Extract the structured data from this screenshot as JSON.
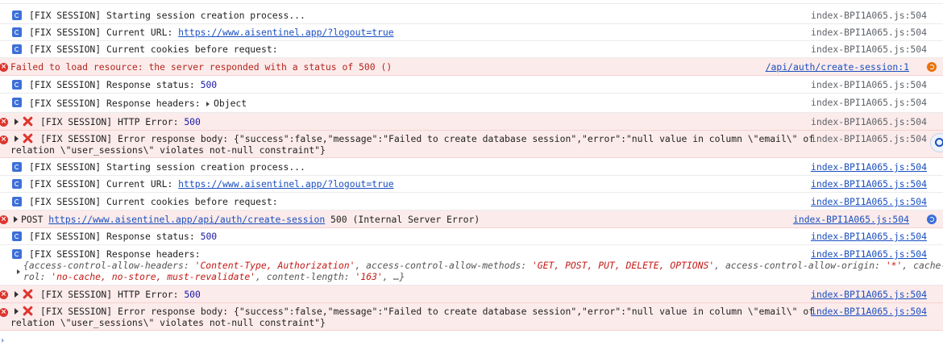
{
  "logs": [
    {
      "type": "info",
      "text": "[FIX SESSION] Starting session creation process...",
      "source": "index-BPI1A065.js:504",
      "source_linked": false
    },
    {
      "type": "info",
      "prefix": "[FIX SESSION] Current URL: ",
      "link": "https://www.aisentinel.app/?logout=true",
      "source": "index-BPI1A065.js:504",
      "source_linked": false
    },
    {
      "type": "info",
      "text": "[FIX SESSION] Current cookies before request:",
      "source": "index-BPI1A065.js:504",
      "source_linked": false
    },
    {
      "type": "error",
      "text": "Failed to load resource: the server responded with a status of 500 ()",
      "source": "/api/auth/create-session:1",
      "source_linked": true
    },
    {
      "type": "info",
      "prefix": "[FIX SESSION] Response status: ",
      "value": "500",
      "source": "index-BPI1A065.js:504",
      "source_linked": false
    },
    {
      "type": "info",
      "prefix": "[FIX SESSION] Response headers: ",
      "object": "Object",
      "source": "index-BPI1A065.js:504",
      "source_linked": false
    },
    {
      "type": "error",
      "prefix": "[FIX SESSION] HTTP Error: ",
      "value": "500",
      "source": "index-BPI1A065.js:504",
      "source_linked": false
    },
    {
      "type": "error",
      "line1": "[FIX SESSION] Error response body: {\"success\":false,\"message\":\"Failed to create database session\",\"error\":\"null value in column \\\"email\\\" of",
      "line2": "relation \\\"user_sessions\\\" violates not-null constraint\"}",
      "source": "index-BPI1A065.js:504",
      "source_linked": false
    },
    {
      "type": "info",
      "text": "[FIX SESSION] Starting session creation process...",
      "source": "index-BPI1A065.js:504",
      "source_linked": true
    },
    {
      "type": "info",
      "prefix": "[FIX SESSION] Current URL: ",
      "link": "https://www.aisentinel.app/?logout=true",
      "source": "index-BPI1A065.js:504",
      "source_linked": true
    },
    {
      "type": "info",
      "text": "[FIX SESSION] Current cookies before request:",
      "source": "index-BPI1A065.js:504",
      "source_linked": true
    },
    {
      "type": "error",
      "method": "POST ",
      "link": "https://www.aisentinel.app/api/auth/create-session",
      "suffix": " 500 (Internal Server Error)",
      "source": "index-BPI1A065.js:504",
      "source_linked": true
    },
    {
      "type": "info",
      "prefix": "[FIX SESSION] Response status: ",
      "value": "500",
      "source": "index-BPI1A065.js:504",
      "source_linked": true
    },
    {
      "type": "info",
      "text": "[FIX SESSION] Response headers:",
      "source": "index-BPI1A065.js:504",
      "source_linked": true,
      "headers_line1": [
        {
          "k": "access-control-allow-headers: ",
          "v": "'Content-Type, Authorization'"
        },
        {
          "k": ", access-control-allow-methods: ",
          "v": "'GET, POST, PUT, DELETE, OPTIONS'"
        },
        {
          "k": ", access-control-allow-origin: ",
          "v": "'*'"
        },
        {
          "k": ", cache-cont",
          "v": ""
        }
      ],
      "headers_line2": [
        {
          "k": "rol: ",
          "v": "'no-cache, no-store, must-revalidate'"
        },
        {
          "k": ", content-length: ",
          "v": "'163'"
        },
        {
          "k": ", …}",
          "v": ""
        }
      ],
      "headers_open": "{"
    },
    {
      "type": "error",
      "prefix": "[FIX SESSION] HTTP Error: ",
      "value": "500",
      "source": "index-BPI1A065.js:504",
      "source_linked": true
    },
    {
      "type": "error",
      "line1": "[FIX SESSION] Error response body: {\"success\":false,\"message\":\"Failed to create database session\",\"error\":\"null value in column \\\"email\\\" of",
      "line2": "relation \\\"user_sessions\\\" violates not-null constraint\"}",
      "source": "index-BPI1A065.js:504",
      "source_linked": true
    }
  ],
  "prompt_symbol": "›"
}
